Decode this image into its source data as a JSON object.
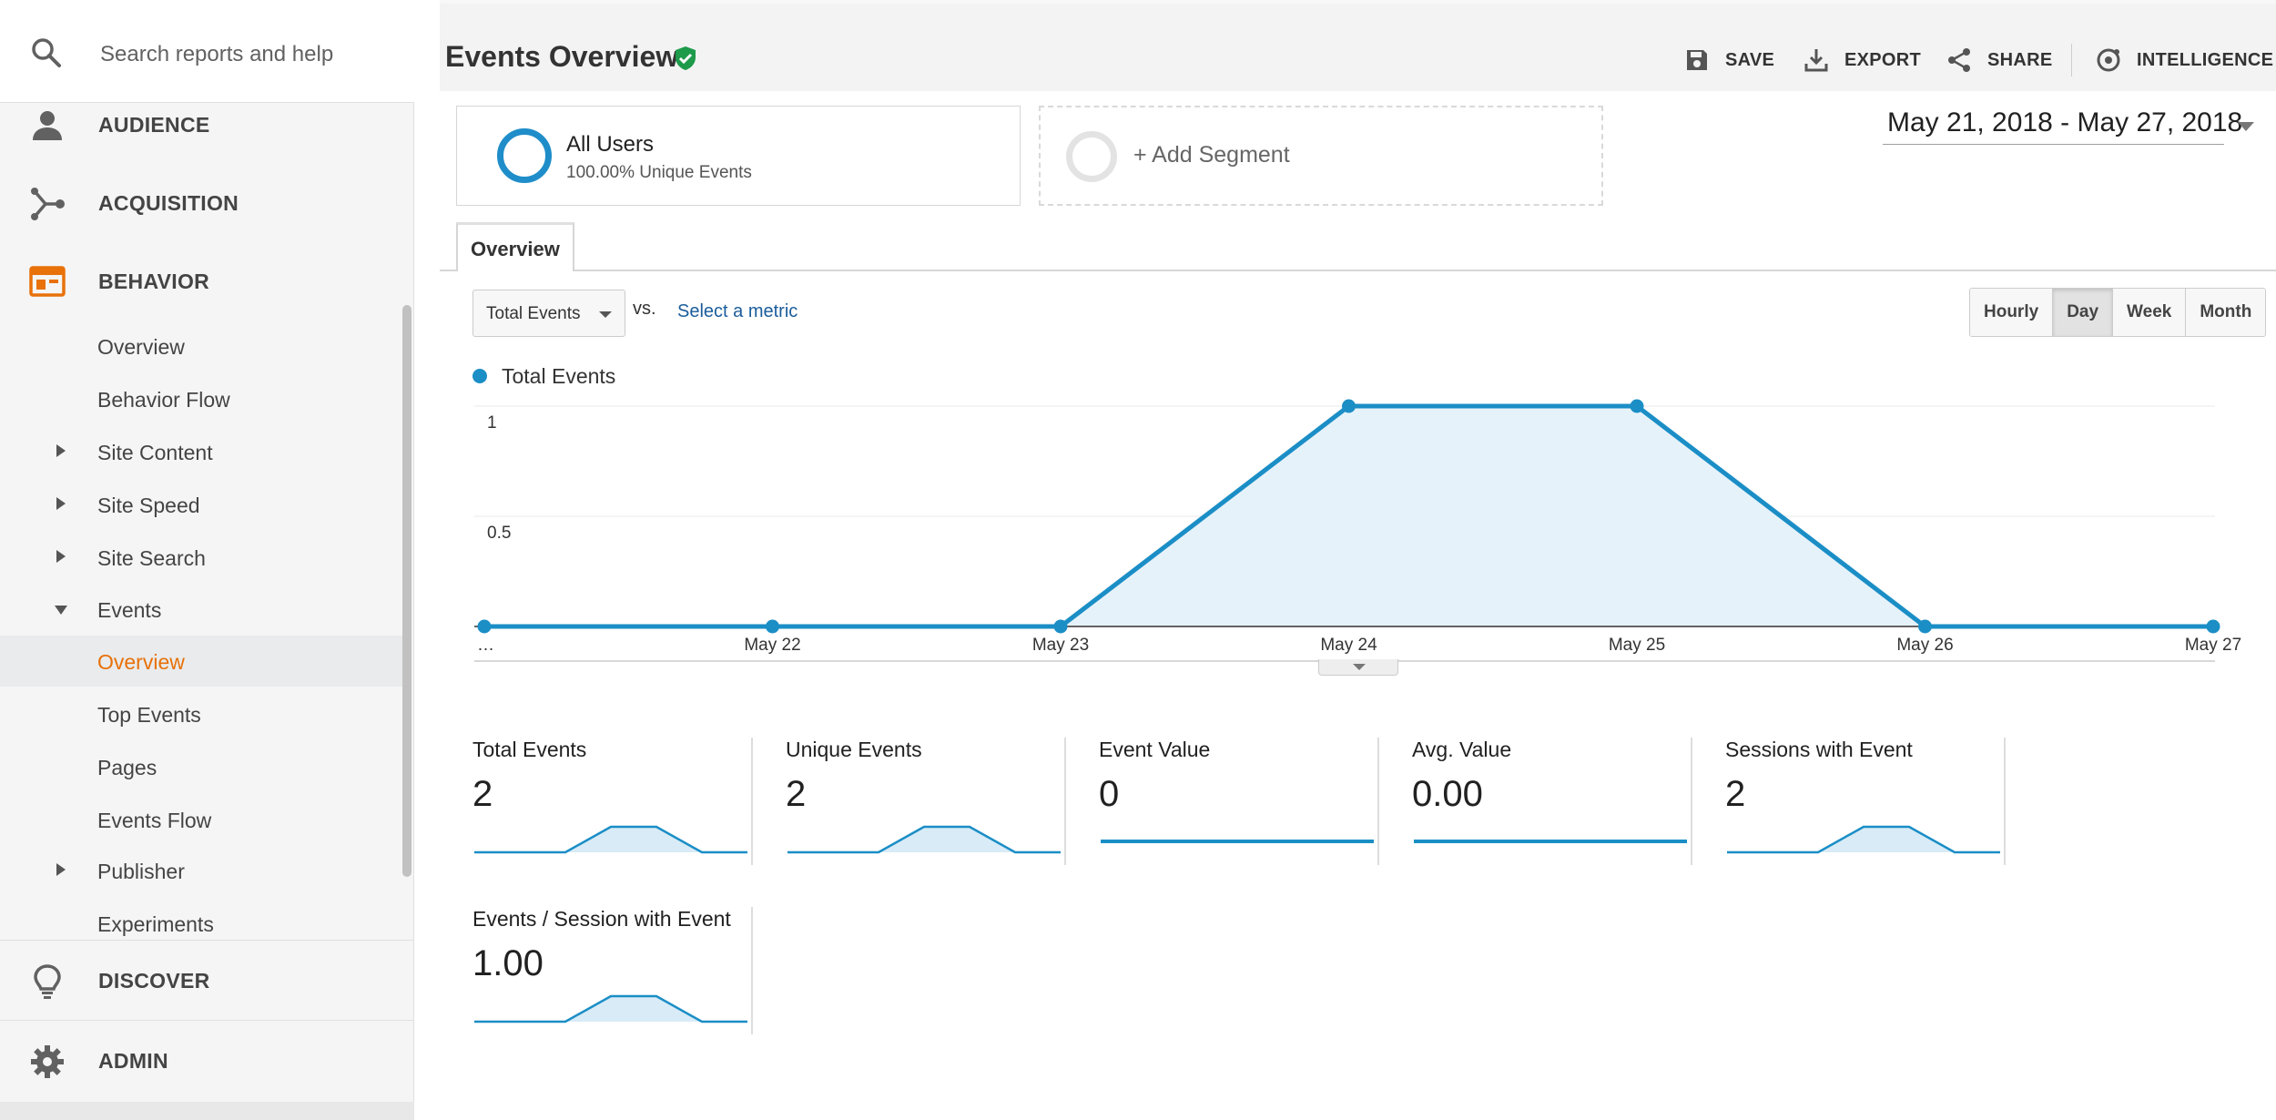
{
  "sidebar": {
    "search_placeholder": "Search reports and help",
    "top_items": [
      {
        "label": "AUDIENCE",
        "icon": "person-icon"
      },
      {
        "label": "ACQUISITION",
        "icon": "acquisition-icon"
      },
      {
        "label": "BEHAVIOR",
        "icon": "behavior-icon"
      }
    ],
    "behavior_items": [
      {
        "label": "Overview"
      },
      {
        "label": "Behavior Flow"
      },
      {
        "label": "Site Content",
        "expand": "collapsed"
      },
      {
        "label": "Site Speed",
        "expand": "collapsed"
      },
      {
        "label": "Site Search",
        "expand": "collapsed"
      },
      {
        "label": "Events",
        "expand": "expanded"
      },
      {
        "label": "Overview",
        "active": true
      },
      {
        "label": "Top Events"
      },
      {
        "label": "Pages"
      },
      {
        "label": "Events Flow"
      },
      {
        "label": "Publisher",
        "expand": "collapsed"
      },
      {
        "label": "Experiments"
      }
    ],
    "bottom_items": [
      {
        "label": "DISCOVER",
        "icon": "lightbulb-icon"
      },
      {
        "label": "ADMIN",
        "icon": "gear-icon"
      }
    ],
    "accent_color": "#e8710a"
  },
  "header": {
    "title": "Events Overview",
    "save_label": "SAVE",
    "export_label": "EXPORT",
    "share_label": "SHARE",
    "intelligence_label": "INTELLIGENCE"
  },
  "segments": {
    "all_users_title": "All Users",
    "all_users_sub": "100.00% Unique Events",
    "add_label": "+ Add Segment"
  },
  "date_range": "May 21, 2018 - May 27, 2018",
  "tabs": {
    "overview": "Overview"
  },
  "controls": {
    "metric": "Total Events",
    "vs": "vs.",
    "select_metric": "Select a metric",
    "periods": [
      "Hourly",
      "Day",
      "Week",
      "Month"
    ],
    "selected_period": "Day"
  },
  "chart_data": {
    "type": "area",
    "series": [
      {
        "name": "Total Events",
        "values": [
          0,
          0,
          0,
          1,
          1,
          0,
          0
        ]
      }
    ],
    "categories": [
      "…",
      "May 22",
      "May 23",
      "May 24",
      "May 25",
      "May 26",
      "May 27"
    ],
    "yticks": [
      "0.5",
      "1"
    ],
    "ylim": [
      0,
      1
    ],
    "color": "#1b8ec6",
    "fill_color": "#e6f2fa",
    "legend": "top-left"
  },
  "scorecards": [
    {
      "label": "Total Events",
      "value": "2",
      "spark": [
        0,
        0,
        0,
        1,
        1,
        0,
        0
      ]
    },
    {
      "label": "Unique Events",
      "value": "2",
      "spark": [
        0,
        0,
        0,
        1,
        1,
        0,
        0
      ]
    },
    {
      "label": "Event Value",
      "value": "0",
      "spark": [
        0,
        0,
        0,
        0,
        0,
        0,
        0
      ]
    },
    {
      "label": "Avg. Value",
      "value": "0.00",
      "spark": [
        0,
        0,
        0,
        0,
        0,
        0,
        0
      ]
    },
    {
      "label": "Sessions with Event",
      "value": "2",
      "spark": [
        0,
        0,
        0,
        1,
        1,
        0,
        0
      ]
    },
    {
      "label": "Events / Session with Event",
      "value": "1.00",
      "spark": [
        0,
        0,
        0,
        1,
        1,
        0,
        0
      ]
    }
  ]
}
